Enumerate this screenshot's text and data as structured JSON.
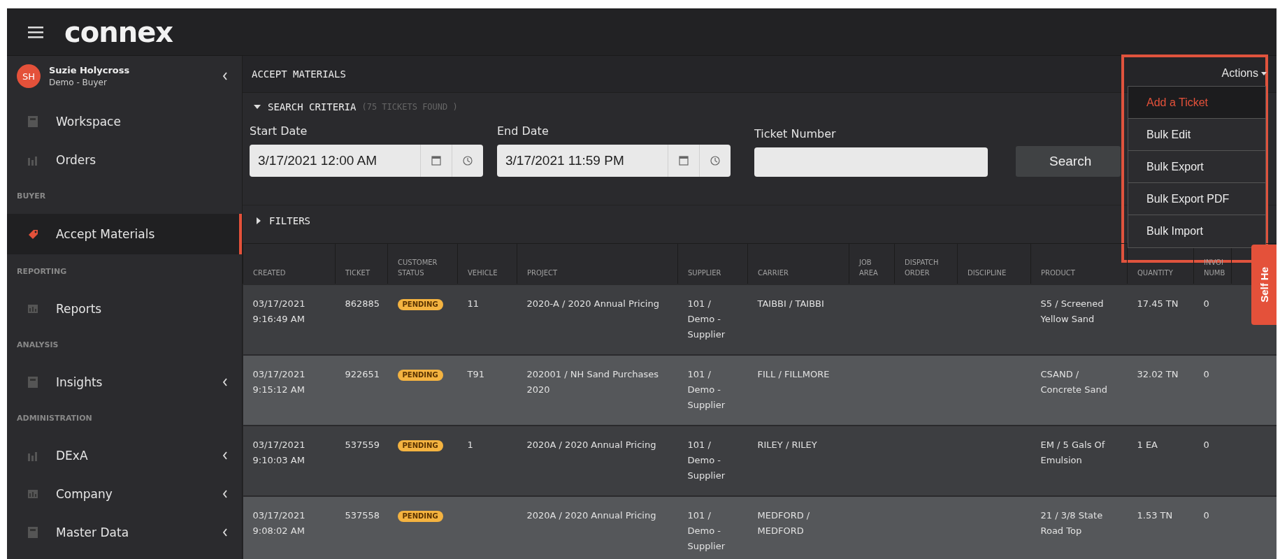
{
  "header": {
    "logo": "connex"
  },
  "user": {
    "initials": "SH",
    "name": "Suzie Holycross",
    "role": "Demo - Buyer",
    "expandable": true
  },
  "sidebar": {
    "items": [
      {
        "kind": "item",
        "label": "Workspace",
        "selected": false,
        "expandable": false
      },
      {
        "kind": "item",
        "label": "Orders",
        "selected": false,
        "expandable": false
      },
      {
        "kind": "section",
        "label": "BUYER"
      },
      {
        "kind": "item",
        "label": "Accept Materials",
        "selected": true,
        "expandable": false
      },
      {
        "kind": "section",
        "label": "REPORTING"
      },
      {
        "kind": "item",
        "label": "Reports",
        "selected": false,
        "expandable": false
      },
      {
        "kind": "section",
        "label": "ANALYSIS"
      },
      {
        "kind": "item",
        "label": "Insights",
        "selected": false,
        "expandable": true
      },
      {
        "kind": "section",
        "label": "ADMINISTRATION"
      },
      {
        "kind": "item",
        "label": "DExA",
        "selected": false,
        "expandable": true
      },
      {
        "kind": "item",
        "label": "Company",
        "selected": false,
        "expandable": true
      },
      {
        "kind": "item",
        "label": "Master Data",
        "selected": false,
        "expandable": true
      }
    ]
  },
  "page": {
    "title": "ACCEPT MATERIALS"
  },
  "search_criteria": {
    "label": "SEARCH CRITERIA",
    "count": "(75 TICKETS FOUND )",
    "expanded": true,
    "start_date": {
      "label": "Start Date",
      "value": "3/17/2021 12:00 AM"
    },
    "end_date": {
      "label": "End Date",
      "value": "3/17/2021 11:59 PM"
    },
    "ticket_number": {
      "label": "Ticket Number"
    },
    "search_button": "Search"
  },
  "filters": {
    "label": "FILTERS",
    "expanded": false
  },
  "actions": {
    "label": "Actions",
    "expanded": true,
    "items": [
      {
        "label": "Add a Ticket",
        "selected": true
      },
      {
        "label": "Bulk Edit",
        "selected": false
      },
      {
        "label": "Bulk Export",
        "selected": false
      },
      {
        "label": "Bulk Export PDF",
        "selected": false
      },
      {
        "label": "Bulk Import",
        "selected": false
      }
    ]
  },
  "table": {
    "columns": [
      "CREATED",
      "TICKET",
      "CUSTOMER STATUS",
      "VEHICLE",
      "PROJECT",
      "SUPPLIER",
      "CARRIER",
      "JOB AREA",
      "DISPATCH ORDER",
      "DISCIPLINE",
      "PRODUCT",
      "QUANTITY",
      "INVOI NUMB"
    ],
    "rows": [
      {
        "created": "03/17/2021 9:16:49 AM",
        "ticket": "862885",
        "status": "PENDING",
        "vehicle": "11",
        "project": "2020-A / 2020 Annual Pricing",
        "supplier": "101 / Demo - Supplier",
        "carrier": "TAIBBI / TAIBBI",
        "product": "S5 / Screened Yellow Sand",
        "quantity": "17.45 TN",
        "invoice": "0"
      },
      {
        "created": "03/17/2021 9:15:12 AM",
        "ticket": "922651",
        "status": "PENDING",
        "vehicle": "T91",
        "project": "202001 / NH Sand Purchases 2020",
        "supplier": "101 / Demo - Supplier",
        "carrier": "FILL / FILLMORE",
        "product": "CSAND / Concrete Sand",
        "quantity": "32.02 TN",
        "invoice": "0"
      },
      {
        "created": "03/17/2021 9:10:03 AM",
        "ticket": "537559",
        "status": "PENDING",
        "vehicle": "1",
        "project": "2020A / 2020 Annual Pricing",
        "supplier": "101 / Demo - Supplier",
        "carrier": "RILEY / RILEY",
        "product": "EM / 5 Gals Of Emulsion",
        "quantity": "1 EA",
        "invoice": "0"
      },
      {
        "created": "03/17/2021 9:08:02 AM",
        "ticket": "537558",
        "status": "PENDING",
        "project": "2020A / 2020 Annual Pricing",
        "supplier": "101 / Demo - Supplier",
        "carrier": "MEDFORD / MEDFORD",
        "product": "21 / 3/8 State Road Top",
        "quantity": "1.53 TN",
        "invoice": "0"
      }
    ]
  },
  "help_tab": {
    "label": "Self He"
  }
}
